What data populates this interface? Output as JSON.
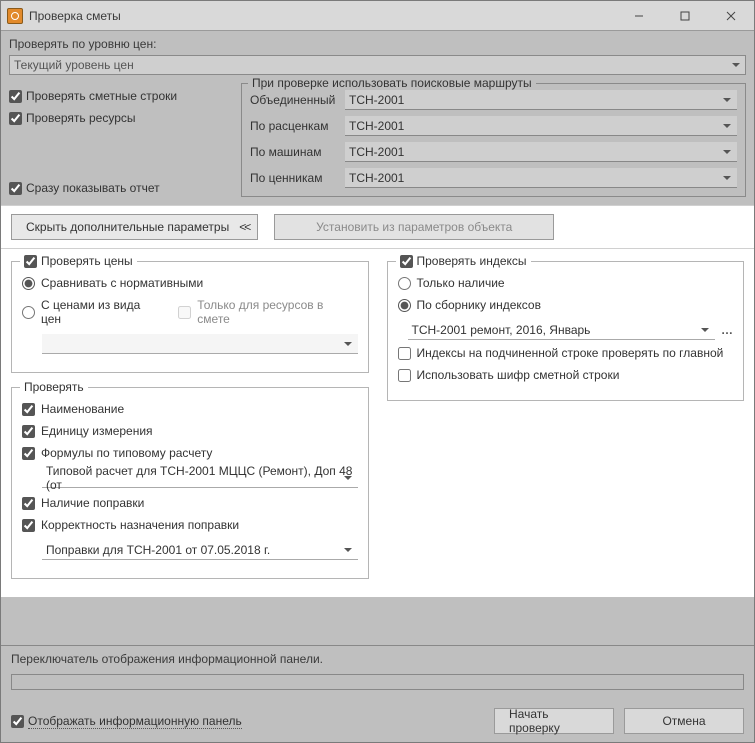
{
  "window": {
    "title": "Проверка сметы"
  },
  "top": {
    "price_level_label": "Проверять по уровню цен:",
    "price_level_value": "Текущий уровень цен"
  },
  "left_checks": {
    "check_smeta_rows": "Проверять сметные строки",
    "check_resources": "Проверять ресурсы",
    "show_report_now": "Сразу показывать отчет"
  },
  "routes": {
    "legend": "При проверке использовать поисковые маршруты",
    "rows": [
      {
        "label": "Объединенный",
        "value": "ТСН-2001"
      },
      {
        "label": "По расценкам",
        "value": "ТСН-2001"
      },
      {
        "label": "По машинам",
        "value": "ТСН-2001"
      },
      {
        "label": "По ценникам",
        "value": "ТСН-2001"
      }
    ]
  },
  "buttons": {
    "hide_params": "Скрыть дополнительные параметры",
    "set_from_object": "Установить из параметров объекта"
  },
  "check_prices": {
    "legend": "Проверять цены",
    "r_normative": "Сравнивать с нормативными",
    "r_from_type": "С ценами из вида цен",
    "only_for_resources": "Только для ресурсов в смете"
  },
  "check_general": {
    "legend": "Проверять",
    "name": "Наименование",
    "unit": "Единицу измерения",
    "formulas": "Формулы по типовому расчету",
    "formulas_dd": "Типовой расчет для ТСН-2001 МЦЦС (Ремонт), Доп 48 (от",
    "has_correction": "Наличие поправки",
    "corr_correct": "Корректность назначения поправки",
    "corr_dd": "Поправки для ТСН-2001 от 07.05.2018 г."
  },
  "check_indexes": {
    "legend": "Проверять индексы",
    "r_only_presence": "Только наличие",
    "r_by_book": "По сборнику индексов",
    "book_dd": "ТСН-2001 ремонт, 2016, Январь",
    "chk_sub_by_main": "Индексы на подчиненной строке проверять по главной",
    "chk_use_cipher": "Использовать шифр сметной строки"
  },
  "info": {
    "msg": "Переключатель отображения информационной панели."
  },
  "footer": {
    "show_info_panel": "Отображать информационную панель",
    "start": "Начать проверку",
    "cancel": "Отмена"
  }
}
